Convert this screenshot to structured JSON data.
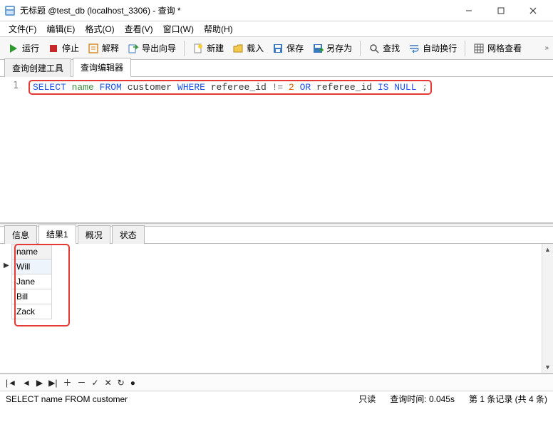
{
  "window": {
    "title": "无标题 @test_db (localhost_3306) - 查询 *"
  },
  "menu": {
    "file": "文件(F)",
    "edit": "编辑(E)",
    "format": "格式(O)",
    "view": "查看(V)",
    "window": "窗口(W)",
    "help": "帮助(H)"
  },
  "toolbar": {
    "run": "运行",
    "stop": "停止",
    "explain": "解释",
    "export_wizard": "导出向导",
    "new": "新建",
    "load": "载入",
    "save": "保存",
    "save_as": "另存为",
    "find": "查找",
    "auto_wrap": "自动换行",
    "grid_view": "网格查看"
  },
  "editor_tabs": {
    "builder": "查询创建工具",
    "editor": "查询编辑器"
  },
  "sql": {
    "line": "1",
    "select": "SELECT",
    "name_col": "name",
    "from": "FROM",
    "table": "customer",
    "where": "WHERE",
    "col1": "referee_id",
    "neq": "!=",
    "val": "2",
    "or": "OR",
    "col2": "referee_id",
    "is": "IS",
    "null": "NULL",
    "semi": ";"
  },
  "result_tabs": {
    "info": "信息",
    "result1": "结果1",
    "profile": "概况",
    "status": "状态"
  },
  "grid": {
    "header": "name",
    "rows": [
      "Will",
      "Jane",
      "Bill",
      "Zack"
    ]
  },
  "status": {
    "query": "SELECT name FROM customer",
    "readonly": "只读",
    "time_label": "查询时间:",
    "time_val": "0.045s",
    "record": "第 1 条记录 (共 4 条)"
  }
}
